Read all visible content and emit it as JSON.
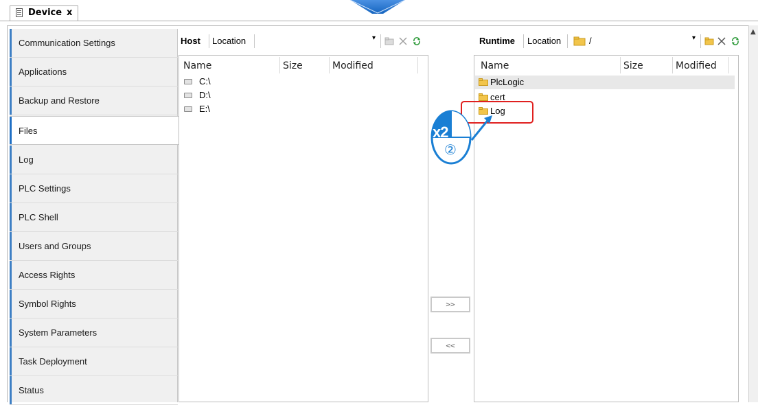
{
  "tabs": [
    {
      "label": "Device",
      "close": "x"
    }
  ],
  "sidebar": {
    "items": [
      {
        "label": "Communication Settings"
      },
      {
        "label": "Applications"
      },
      {
        "label": "Backup and Restore"
      },
      {
        "label": "Files",
        "active": true
      },
      {
        "label": "Log"
      },
      {
        "label": "PLC Settings"
      },
      {
        "label": "PLC Shell"
      },
      {
        "label": "Users and Groups"
      },
      {
        "label": "Access Rights"
      },
      {
        "label": "Symbol Rights"
      },
      {
        "label": "System Parameters"
      },
      {
        "label": "Task Deployment"
      },
      {
        "label": "Status"
      }
    ]
  },
  "host": {
    "title": "Host",
    "location_label": "Location",
    "columns": {
      "name": "Name",
      "size": "Size",
      "modified": "Modified"
    },
    "items": [
      {
        "label": "C:\\",
        "icon": "drive-icon"
      },
      {
        "label": "D:\\",
        "icon": "drive-icon"
      },
      {
        "label": "E:\\",
        "icon": "drive-icon"
      }
    ]
  },
  "runtime": {
    "title": "Runtime",
    "location_label": "Location",
    "location_value": "/",
    "columns": {
      "name": "Name",
      "size": "Size",
      "modified": "Modified"
    },
    "items": [
      {
        "label": "PlcLogic",
        "icon": "folder-icon",
        "selected": true
      },
      {
        "label": "cert",
        "icon": "folder-icon"
      },
      {
        "label": "Log",
        "icon": "folder-icon"
      }
    ]
  },
  "transfer": {
    "to_runtime": ">>",
    "to_host": "<<"
  },
  "annotation": {
    "multiplier": "x2",
    "step": "②",
    "highlight_color": "#e0201f",
    "badge_color": "#1a7fd4"
  }
}
